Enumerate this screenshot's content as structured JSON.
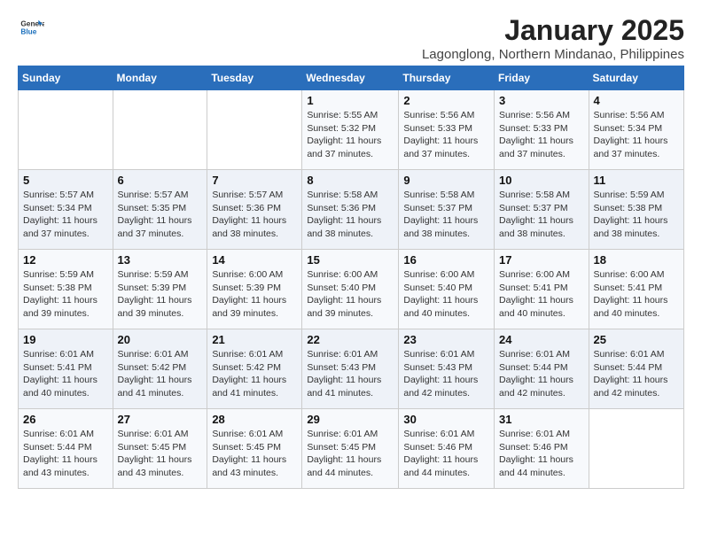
{
  "logo": {
    "line1": "General",
    "line2": "Blue"
  },
  "title": "January 2025",
  "subtitle": "Lagonglong, Northern Mindanao, Philippines",
  "days_of_week": [
    "Sunday",
    "Monday",
    "Tuesday",
    "Wednesday",
    "Thursday",
    "Friday",
    "Saturday"
  ],
  "weeks": [
    [
      {
        "day": "",
        "info": ""
      },
      {
        "day": "",
        "info": ""
      },
      {
        "day": "",
        "info": ""
      },
      {
        "day": "1",
        "info": "Sunrise: 5:55 AM\nSunset: 5:32 PM\nDaylight: 11 hours\nand 37 minutes."
      },
      {
        "day": "2",
        "info": "Sunrise: 5:56 AM\nSunset: 5:33 PM\nDaylight: 11 hours\nand 37 minutes."
      },
      {
        "day": "3",
        "info": "Sunrise: 5:56 AM\nSunset: 5:33 PM\nDaylight: 11 hours\nand 37 minutes."
      },
      {
        "day": "4",
        "info": "Sunrise: 5:56 AM\nSunset: 5:34 PM\nDaylight: 11 hours\nand 37 minutes."
      }
    ],
    [
      {
        "day": "5",
        "info": "Sunrise: 5:57 AM\nSunset: 5:34 PM\nDaylight: 11 hours\nand 37 minutes."
      },
      {
        "day": "6",
        "info": "Sunrise: 5:57 AM\nSunset: 5:35 PM\nDaylight: 11 hours\nand 37 minutes."
      },
      {
        "day": "7",
        "info": "Sunrise: 5:57 AM\nSunset: 5:36 PM\nDaylight: 11 hours\nand 38 minutes."
      },
      {
        "day": "8",
        "info": "Sunrise: 5:58 AM\nSunset: 5:36 PM\nDaylight: 11 hours\nand 38 minutes."
      },
      {
        "day": "9",
        "info": "Sunrise: 5:58 AM\nSunset: 5:37 PM\nDaylight: 11 hours\nand 38 minutes."
      },
      {
        "day": "10",
        "info": "Sunrise: 5:58 AM\nSunset: 5:37 PM\nDaylight: 11 hours\nand 38 minutes."
      },
      {
        "day": "11",
        "info": "Sunrise: 5:59 AM\nSunset: 5:38 PM\nDaylight: 11 hours\nand 38 minutes."
      }
    ],
    [
      {
        "day": "12",
        "info": "Sunrise: 5:59 AM\nSunset: 5:38 PM\nDaylight: 11 hours\nand 39 minutes."
      },
      {
        "day": "13",
        "info": "Sunrise: 5:59 AM\nSunset: 5:39 PM\nDaylight: 11 hours\nand 39 minutes."
      },
      {
        "day": "14",
        "info": "Sunrise: 6:00 AM\nSunset: 5:39 PM\nDaylight: 11 hours\nand 39 minutes."
      },
      {
        "day": "15",
        "info": "Sunrise: 6:00 AM\nSunset: 5:40 PM\nDaylight: 11 hours\nand 39 minutes."
      },
      {
        "day": "16",
        "info": "Sunrise: 6:00 AM\nSunset: 5:40 PM\nDaylight: 11 hours\nand 40 minutes."
      },
      {
        "day": "17",
        "info": "Sunrise: 6:00 AM\nSunset: 5:41 PM\nDaylight: 11 hours\nand 40 minutes."
      },
      {
        "day": "18",
        "info": "Sunrise: 6:00 AM\nSunset: 5:41 PM\nDaylight: 11 hours\nand 40 minutes."
      }
    ],
    [
      {
        "day": "19",
        "info": "Sunrise: 6:01 AM\nSunset: 5:41 PM\nDaylight: 11 hours\nand 40 minutes."
      },
      {
        "day": "20",
        "info": "Sunrise: 6:01 AM\nSunset: 5:42 PM\nDaylight: 11 hours\nand 41 minutes."
      },
      {
        "day": "21",
        "info": "Sunrise: 6:01 AM\nSunset: 5:42 PM\nDaylight: 11 hours\nand 41 minutes."
      },
      {
        "day": "22",
        "info": "Sunrise: 6:01 AM\nSunset: 5:43 PM\nDaylight: 11 hours\nand 41 minutes."
      },
      {
        "day": "23",
        "info": "Sunrise: 6:01 AM\nSunset: 5:43 PM\nDaylight: 11 hours\nand 42 minutes."
      },
      {
        "day": "24",
        "info": "Sunrise: 6:01 AM\nSunset: 5:44 PM\nDaylight: 11 hours\nand 42 minutes."
      },
      {
        "day": "25",
        "info": "Sunrise: 6:01 AM\nSunset: 5:44 PM\nDaylight: 11 hours\nand 42 minutes."
      }
    ],
    [
      {
        "day": "26",
        "info": "Sunrise: 6:01 AM\nSunset: 5:44 PM\nDaylight: 11 hours\nand 43 minutes."
      },
      {
        "day": "27",
        "info": "Sunrise: 6:01 AM\nSunset: 5:45 PM\nDaylight: 11 hours\nand 43 minutes."
      },
      {
        "day": "28",
        "info": "Sunrise: 6:01 AM\nSunset: 5:45 PM\nDaylight: 11 hours\nand 43 minutes."
      },
      {
        "day": "29",
        "info": "Sunrise: 6:01 AM\nSunset: 5:45 PM\nDaylight: 11 hours\nand 44 minutes."
      },
      {
        "day": "30",
        "info": "Sunrise: 6:01 AM\nSunset: 5:46 PM\nDaylight: 11 hours\nand 44 minutes."
      },
      {
        "day": "31",
        "info": "Sunrise: 6:01 AM\nSunset: 5:46 PM\nDaylight: 11 hours\nand 44 minutes."
      },
      {
        "day": "",
        "info": ""
      }
    ]
  ]
}
